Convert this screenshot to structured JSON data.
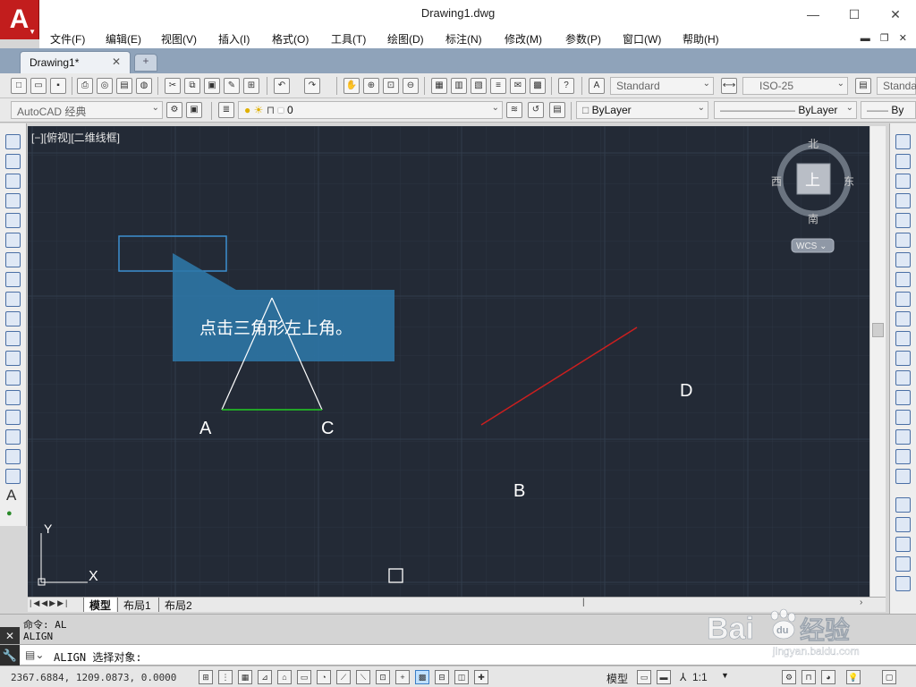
{
  "window": {
    "title": "Drawing1.dwg",
    "minimize": "—",
    "maximize": "☐",
    "close": "✕"
  },
  "menu": [
    "文件(F)",
    "编辑(E)",
    "视图(V)",
    "插入(I)",
    "格式(O)",
    "工具(T)",
    "绘图(D)",
    "标注(N)",
    "修改(M)",
    "参数(P)",
    "窗口(W)",
    "帮助(H)"
  ],
  "tabs": {
    "document": "Drawing1*",
    "close": "✕"
  },
  "toolbar": {
    "text_style": "Standard",
    "dim_style": "ISO-25",
    "table_style": "Standa",
    "workspace": "AutoCAD 经典",
    "layer": "0",
    "color": "ByLayer",
    "linetype": "ByLayer",
    "lineweight": "By"
  },
  "viewport": {
    "label": "[−][俯视][二维线框]",
    "viewcube": {
      "north": "北",
      "south": "南",
      "east": "东",
      "west": "西",
      "top": "上",
      "wcs": "WCS ⌄"
    },
    "ucs": {
      "x": "X",
      "y": "Y"
    }
  },
  "drawing": {
    "points": {
      "A": "A",
      "B": "B",
      "C": "C",
      "D": "D"
    },
    "tooltip": "点击三角形左上角。",
    "colors": {
      "triangle": "#ffffff",
      "base": "#22cc22",
      "line": "#cc1f1f",
      "callout": "#2e78a8",
      "canvas": "#232a36"
    }
  },
  "layout_tabs": [
    "模型",
    "布局1",
    "布局2"
  ],
  "command": {
    "history": [
      "命令: AL",
      "ALIGN"
    ],
    "prompt": "ALIGN 选择对象:"
  },
  "status": {
    "coordinates": "2367.6884, 1209.0873, 0.0000",
    "model": "模型",
    "scale": "1:1"
  },
  "watermark": {
    "brand": "Bai",
    "brand2": "du",
    "suffix": "经验",
    "url": "jingyan.baidu.com"
  }
}
